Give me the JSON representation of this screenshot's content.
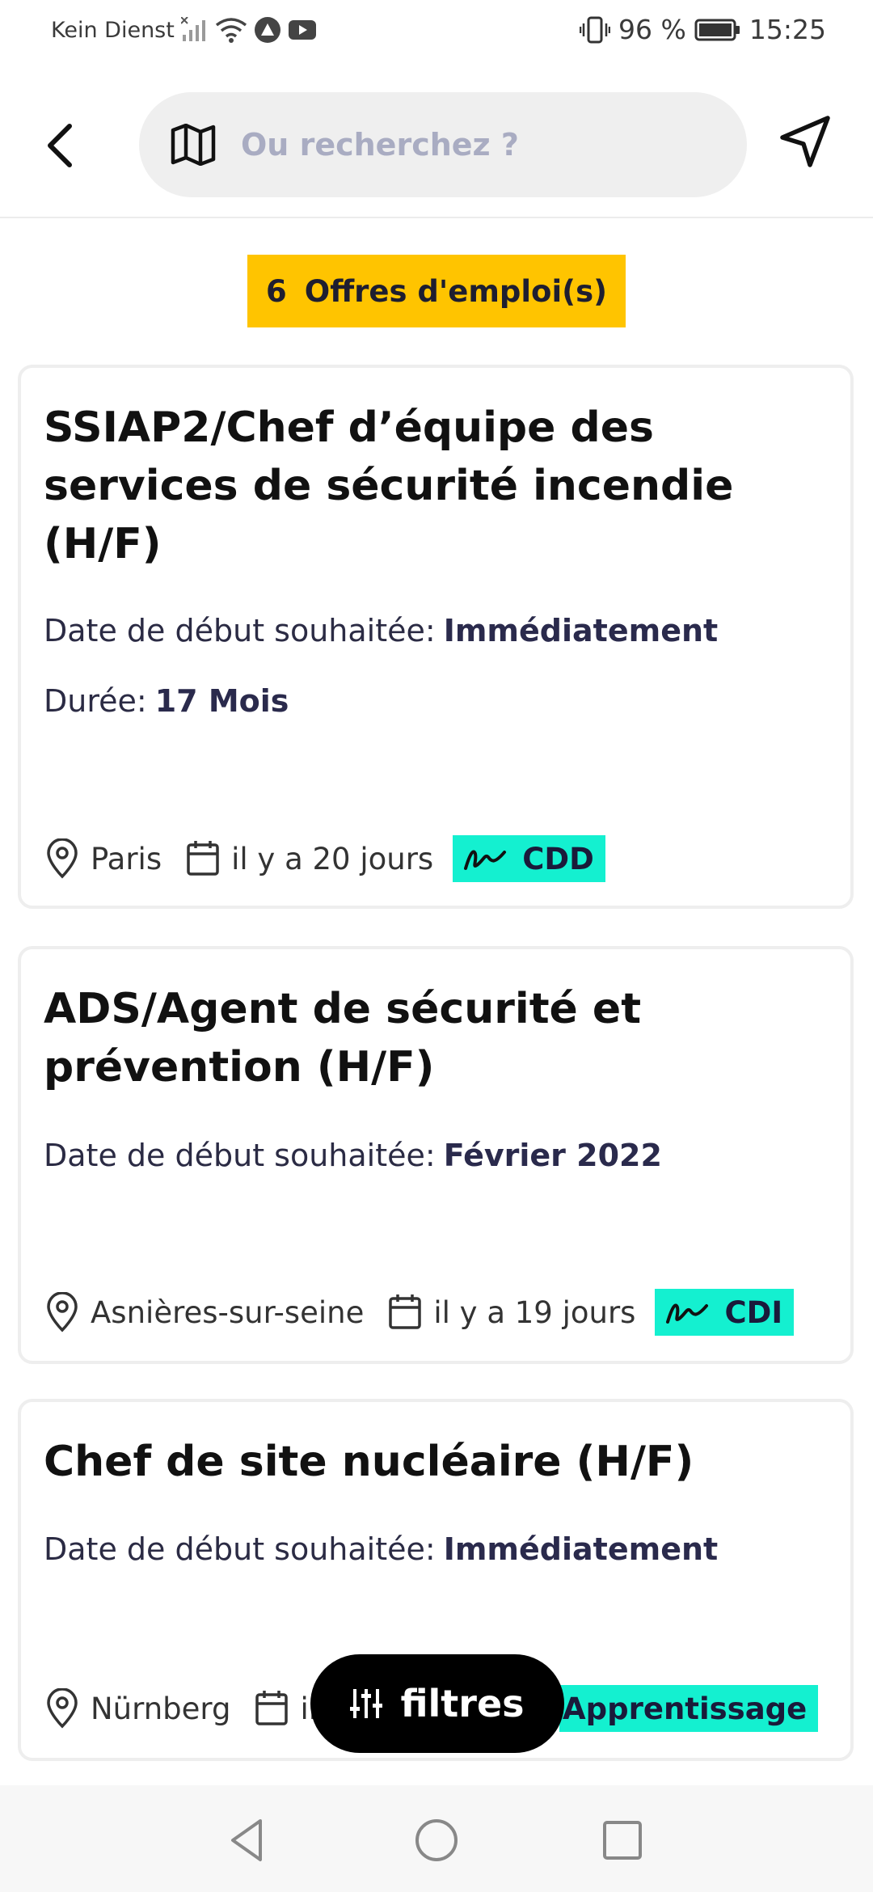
{
  "status_bar": {
    "carrier": "Kein Dienst",
    "battery": "96 %",
    "time": "15:25"
  },
  "header": {
    "search_placeholder": "Ou recherchez ?",
    "icons": [
      "back-arrow-icon",
      "map-icon",
      "location-arrow-icon"
    ]
  },
  "results": {
    "count": "6",
    "label": "Offres d'emploi(s)"
  },
  "jobs": [
    {
      "title": "SSIAP2/Chef d’équipe des services de sécurité incendie (H/F)",
      "start_label": "Date de début souhaitée:",
      "start_value": "Immédiatement",
      "duration_label": "Durée:",
      "duration_value": "17 Mois",
      "location": "Paris",
      "posted": "il y a 20 jours",
      "contract": "CDD"
    },
    {
      "title": "ADS/Agent de sécurité et prévention (H/F)",
      "start_label": "Date de début souhaitée:",
      "start_value": "Février 2022",
      "location": "Asnières-sur-seine",
      "posted": "il y a 19 jours",
      "contract": "CDI"
    },
    {
      "title": "Chef de site nucléaire (H/F)",
      "start_label": "Date de début souhaitée:",
      "start_value": "Immédiatement",
      "location": "Nürnberg",
      "posted": "il",
      "contract": "Apprentissage"
    }
  ],
  "filters_button": {
    "label": "filtres"
  },
  "colors": {
    "count_badge": "#ffc400",
    "contract_tag": "#14f0d0",
    "filters_button": "#000000"
  }
}
